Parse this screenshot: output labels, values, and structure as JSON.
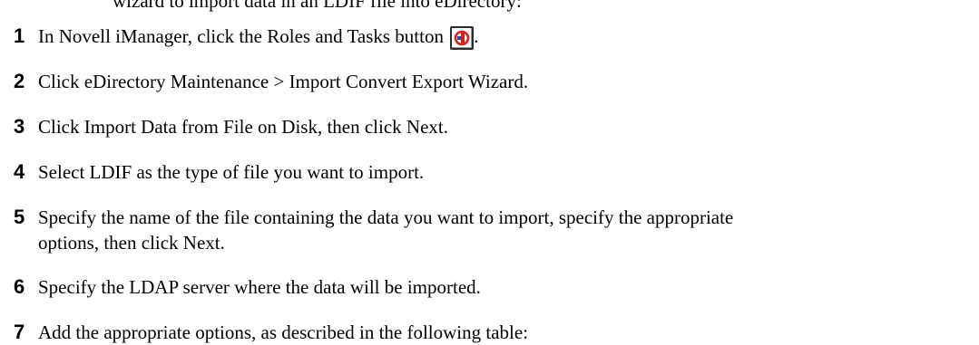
{
  "intro_text": "wizard to import data in an LDIF file into eDirectory:",
  "steps": [
    {
      "num": "1",
      "text": "In Novell iManager, click the Roles and Tasks button",
      "suffix": "."
    },
    {
      "num": "2",
      "text": "Click eDirectory Maintenance > Import Convert Export Wizard."
    },
    {
      "num": "3",
      "text": "Click Import Data from File on Disk, then click Next."
    },
    {
      "num": "4",
      "text": "Select LDIF as the type of file you want to import."
    },
    {
      "num": "5",
      "text": "Specify the name of the file containing the data you want to import, specify the appropriate",
      "text2": "options, then click Next."
    },
    {
      "num": "6",
      "text": "Specify the LDAP server where the data will be imported."
    },
    {
      "num": "7",
      "text": "Add the appropriate options, as described in the following table:"
    }
  ],
  "icons": {
    "roles_button": "roles-and-tasks-icon"
  },
  "colors": {
    "text": "#000000",
    "icon_red": "#d8201c",
    "icon_blue": "#2a4aa8"
  }
}
